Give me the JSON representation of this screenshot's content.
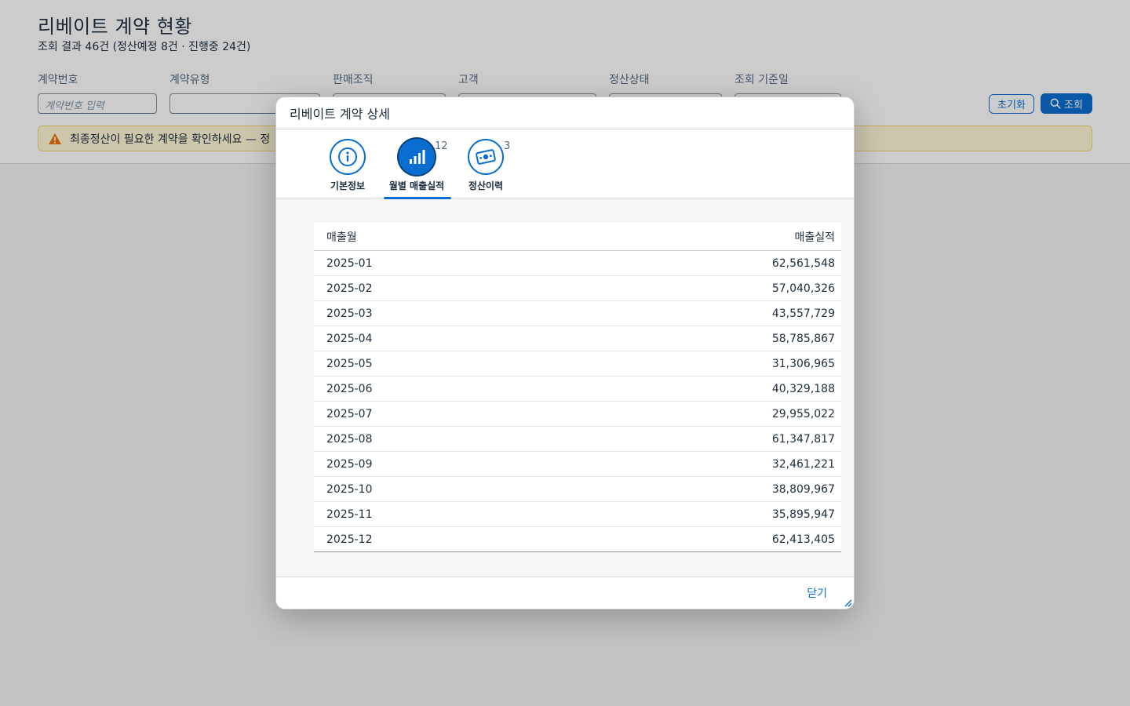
{
  "page": {
    "title": "리베이트 계약 현황",
    "subtitle": "조회 결과 46건 (정산예정 8건 · 진행중 24건)"
  },
  "filters": {
    "contract_no_label": "계약번호",
    "contract_no_placeholder": "계약번호 입력",
    "contract_type_label": "계약유형",
    "sales_org_label": "판매조직",
    "customer_label": "고객",
    "settle_status_label": "정산상태",
    "base_date_label": "조회 기준일",
    "reset_label": "초기화",
    "search_label": "조회"
  },
  "warning": {
    "text": "최종정산이 필요한 계약을 확인하세요 — 정",
    "color": "#e9730c"
  },
  "dialog": {
    "title": "리베이트 계약 상세",
    "close_label": "닫기",
    "tabs": [
      {
        "label": "기본정보",
        "icon": "info-icon",
        "count": ""
      },
      {
        "label": "월별 매출실적",
        "icon": "bar-chart-icon",
        "count": "12"
      },
      {
        "label": "정산이력",
        "icon": "money-icon",
        "count": "3"
      }
    ],
    "active_tab": 1,
    "table": {
      "columns": [
        "매출월",
        "매출실적"
      ],
      "rows": [
        {
          "month": "2025-01",
          "amount": "62,561,548"
        },
        {
          "month": "2025-02",
          "amount": "57,040,326"
        },
        {
          "month": "2025-03",
          "amount": "43,557,729"
        },
        {
          "month": "2025-04",
          "amount": "58,785,867"
        },
        {
          "month": "2025-05",
          "amount": "31,306,965"
        },
        {
          "month": "2025-06",
          "amount": "40,329,188"
        },
        {
          "month": "2025-07",
          "amount": "29,955,022"
        },
        {
          "month": "2025-08",
          "amount": "61,347,817"
        },
        {
          "month": "2025-09",
          "amount": "32,461,221"
        },
        {
          "month": "2025-10",
          "amount": "38,809,967"
        },
        {
          "month": "2025-11",
          "amount": "35,895,947"
        },
        {
          "month": "2025-12",
          "amount": "62,413,405"
        }
      ]
    }
  },
  "colors": {
    "accent": "#0a6ed1",
    "text": "#1d2d3e"
  }
}
